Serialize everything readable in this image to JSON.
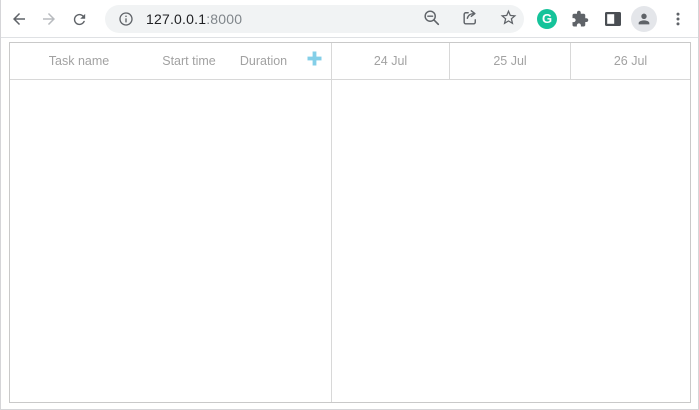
{
  "browser": {
    "toolbar": {
      "url_host": "127.0.0.1",
      "url_port": ":8000",
      "grammarly_letter": "G"
    }
  },
  "gantt": {
    "grid_columns": [
      {
        "label": "Task name"
      },
      {
        "label": "Start time"
      },
      {
        "label": "Duration"
      }
    ],
    "add_column_icon": "plus-icon",
    "timeline_scale": [
      {
        "label": "24 Jul"
      },
      {
        "label": "25 Jul"
      },
      {
        "label": "26 Jul"
      }
    ],
    "rows": []
  },
  "icons": {
    "back": "arrow-left",
    "forward": "arrow-right",
    "reload": "refresh-circular-arrow",
    "site_info": "info-circle",
    "zoom_indicator": "magnifier-minus",
    "share": "share-arrow-box",
    "bookmark": "star-outline",
    "grammarly": "g-green-circle",
    "extensions": "puzzle-piece",
    "side_panel": "split-square",
    "profile": "person-circle",
    "menu": "vertical-ellipsis",
    "add_column": "plus-cross"
  },
  "colors": {
    "toolbar_icon_gray": "#5f6368",
    "disabled_icon_gray": "#b8bbbf",
    "grammarly_green": "#15c39a",
    "accent_add_button": "#84cfe8",
    "header_text_gray": "#a2a2a2",
    "gantt_outer_border": "#c9c9c9",
    "gantt_inner_border": "#d8d8d8",
    "window_frame_gray": "#d5d5d8"
  }
}
